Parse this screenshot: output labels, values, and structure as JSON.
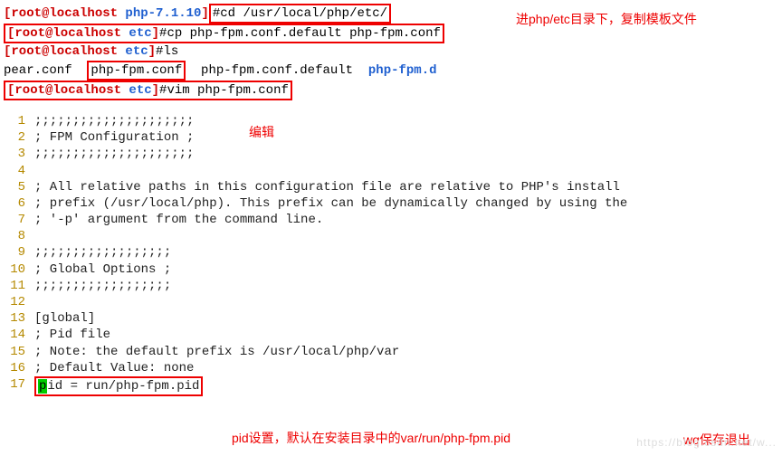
{
  "terminal": {
    "line1": {
      "prefix": "[root@localhost ",
      "dir": "php-7.1.10",
      "suffix": "]",
      "hash": "#",
      "cmd": "cd /usr/local/php/etc/"
    },
    "line2": {
      "prefix": "[root@localhost ",
      "dir": "etc",
      "suffix": "]",
      "hash": "#",
      "cmd": "cp php-fpm.conf.default php-fpm.conf"
    },
    "line3": {
      "prefix": "[root@localhost ",
      "dir": "etc",
      "suffix": "]",
      "hash": "#",
      "cmd": "ls"
    },
    "line4": {
      "a": "pear.conf  ",
      "b": "php-fpm.conf",
      "c": "  php-fpm.conf.default  ",
      "d": "php-fpm.d"
    },
    "line5": {
      "prefix": "[root@localhost ",
      "dir": "etc",
      "suffix": "]",
      "hash": "#",
      "cmd": "vim php-fpm.conf"
    }
  },
  "annotations": {
    "a1": "进php/etc目录下，复制模板文件",
    "a2": "编辑",
    "a3": "pid设置，默认在安装目录中的var/run/php-fpm.pid",
    "a4": "wq保存退出"
  },
  "editor": {
    "l1": ";;;;;;;;;;;;;;;;;;;;;",
    "l2": "; FPM Configuration ;",
    "l3": ";;;;;;;;;;;;;;;;;;;;;",
    "l4": "",
    "l5": "; All relative paths in this configuration file are relative to PHP's install",
    "l6": "; prefix (/usr/local/php). This prefix can be dynamically changed by using the",
    "l7": "; '-p' argument from the command line.",
    "l8": "",
    "l9": ";;;;;;;;;;;;;;;;;;",
    "l10": "; Global Options ;",
    "l11": ";;;;;;;;;;;;;;;;;;",
    "l12": "",
    "l13": "[global]",
    "l14": "; Pid file",
    "l15": "; Note: the default prefix is /usr/local/php/var",
    "l16": "; Default Value: none",
    "l17_cursor": "p",
    "l17_rest": "id = run/php-fpm.pid"
  },
  "ln": {
    "n1": "1",
    "n2": "2",
    "n3": "3",
    "n4": "4",
    "n5": "5",
    "n6": "6",
    "n7": "7",
    "n8": "8",
    "n9": "9",
    "n10": "10",
    "n11": "11",
    "n12": "12",
    "n13": "13",
    "n14": "14",
    "n15": "15",
    "n16": "16",
    "n17": "17"
  },
  "watermark": "https://blog.csdn.net/w..."
}
